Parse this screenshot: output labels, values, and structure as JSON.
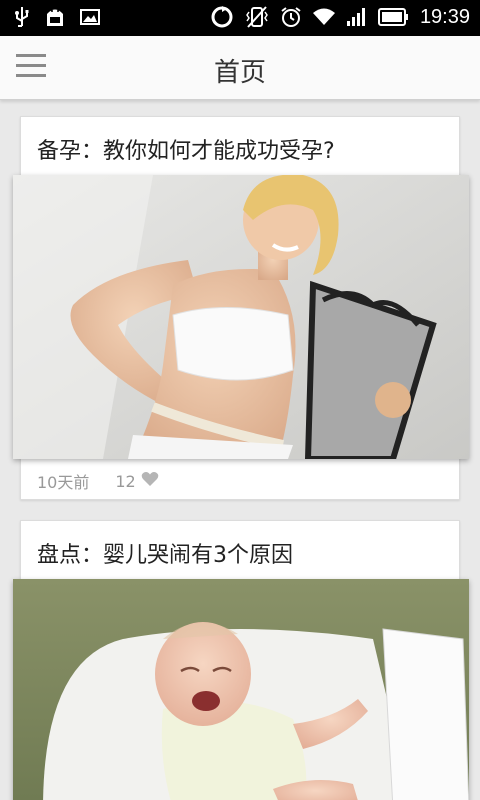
{
  "status_bar": {
    "time": "19:39",
    "icons": [
      "usb-icon",
      "android-debug-icon",
      "image-notification-icon",
      "sync-icon",
      "vibrate-icon",
      "alarm-icon",
      "wifi-icon",
      "signal-icon",
      "battery-icon"
    ]
  },
  "header": {
    "title": "首页",
    "menu_icon": "hamburger-menu-icon"
  },
  "feed": {
    "articles": [
      {
        "title": "备孕：教你如何才能成功受孕?",
        "time": "10天前",
        "likes": "12",
        "like_icon": "heart-icon"
      },
      {
        "title": "盘点：婴儿哭闹有3个原因"
      }
    ]
  }
}
